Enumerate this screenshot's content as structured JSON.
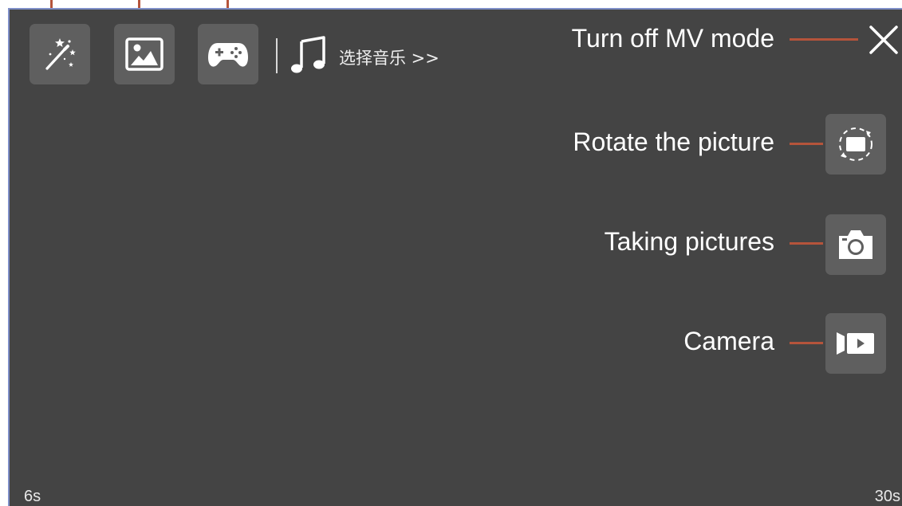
{
  "toolbar": {
    "effects_icon": "magic-wand-icon",
    "image_icon": "image-icon",
    "game_icon": "gamepad-icon",
    "music_icon": "music-note-icon",
    "music_label": "选择音乐 >>"
  },
  "callouts": {
    "close": "Turn off MV mode",
    "rotate": "Rotate the picture",
    "photo": "Taking pictures",
    "video": "Camera"
  },
  "side_buttons": {
    "close_icon": "close-icon",
    "rotate_icon": "rotate-frame-icon",
    "photo_icon": "camera-icon",
    "video_icon": "video-camera-icon"
  },
  "timeline": {
    "start": "6s",
    "end": "30s"
  },
  "colors": {
    "background": "#444444",
    "button": "#5f5f5f",
    "leader_line": "#b5543b",
    "text": "#ffffff"
  }
}
